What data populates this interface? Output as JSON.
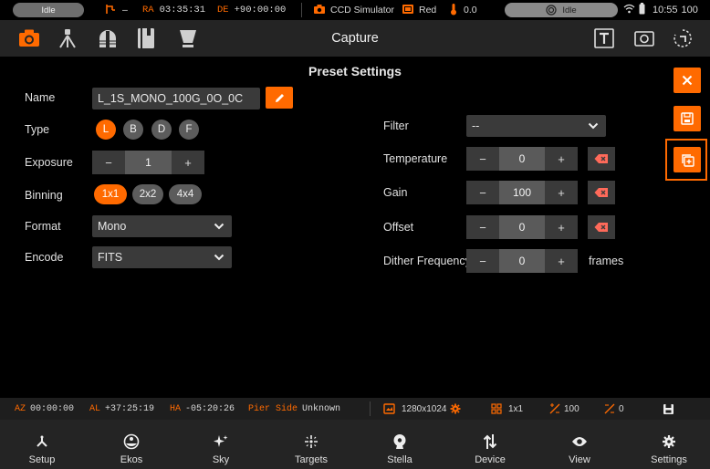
{
  "status_bar": {
    "mount_status": "Idle",
    "tracking_label": "–",
    "ra_label": "RA",
    "ra_value": "03:35:31",
    "de_label": "DE",
    "de_value": "+90:00:00",
    "camera_name": "CCD Simulator",
    "filter_name": "Red",
    "temperature": "0.0",
    "focus_status": "Idle",
    "time": "10:55",
    "battery": "100"
  },
  "toolbar": {
    "title": "Capture",
    "module_icons": [
      "camera-icon",
      "telescope-icon",
      "observatory-icon",
      "notebook-icon",
      "flat-panel-icon"
    ],
    "right_icons": [
      "text-overlay-icon",
      "frame-icon",
      "rotate-icon"
    ]
  },
  "preset": {
    "heading": "Preset Settings",
    "name_label": "Name",
    "name_value": "L_1S_MONO_100G_0O_0C",
    "type_label": "Type",
    "types": [
      "L",
      "B",
      "D",
      "F"
    ],
    "type_selected": "L",
    "exposure_label": "Exposure",
    "exposure_minus": "−",
    "exposure_value": "1",
    "exposure_plus": "+",
    "binning_label": "Binning",
    "binnings": [
      "1x1",
      "2x2",
      "4x4"
    ],
    "binning_selected": "1x1",
    "format_label": "Format",
    "format_value": "Mono",
    "encode_label": "Encode",
    "encode_value": "FITS",
    "filter_label": "Filter",
    "filter_value": "--",
    "temperature_label": "Temperature",
    "temperature_value": "0",
    "gain_label": "Gain",
    "gain_value": "100",
    "offset_label": "Offset",
    "offset_value": "0",
    "dither_label": "Dither Frequency",
    "dither_value": "0",
    "dither_unit": "frames",
    "minus": "−",
    "plus": "+"
  },
  "info_bar": {
    "az_label": "AZ",
    "az_value": "00:00:00",
    "al_label": "AL",
    "al_value": "+37:25:19",
    "ha_label": "HA",
    "ha_value": "-05:20:26",
    "pier_label": "Pier Side",
    "pier_value": "Unknown",
    "resolution": "1280x1024",
    "binning": "1x1",
    "gain": "100",
    "offset": "0"
  },
  "bottom_nav": [
    {
      "label": "Setup",
      "icon": "setup-icon"
    },
    {
      "label": "Ekos",
      "icon": "ekos-icon"
    },
    {
      "label": "Sky",
      "icon": "sky-icon"
    },
    {
      "label": "Targets",
      "icon": "targets-icon"
    },
    {
      "label": "Stella",
      "icon": "stella-icon"
    },
    {
      "label": "Device",
      "icon": "device-icon"
    },
    {
      "label": "View",
      "icon": "view-icon"
    },
    {
      "label": "Settings",
      "icon": "settings-icon"
    }
  ],
  "colors": {
    "accent": "#ff6a00",
    "background": "#000000",
    "toolbar": "#242424",
    "control": "#3a3a3a",
    "clear_icon": "#ff6a5a"
  }
}
